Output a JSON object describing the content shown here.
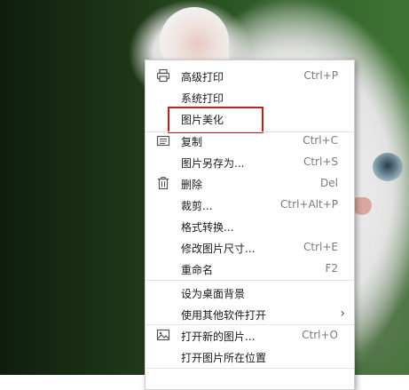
{
  "menu": {
    "items": [
      {
        "label": "高级打印",
        "shortcut": "Ctrl+P",
        "icon": "printer-icon"
      },
      {
        "label": "系统打印",
        "shortcut": ""
      },
      {
        "label": "图片美化",
        "shortcut": ""
      },
      {
        "label": "复制",
        "shortcut": "Ctrl+C",
        "icon": "copy-icon"
      },
      {
        "label": "图片另存为...",
        "shortcut": "Ctrl+S"
      },
      {
        "label": "删除",
        "shortcut": "Del",
        "icon": "trash-icon"
      },
      {
        "label": "裁剪...",
        "shortcut": "Ctrl+Alt+P"
      },
      {
        "label": "格式转换...",
        "shortcut": ""
      },
      {
        "label": "修改图片尺寸...",
        "shortcut": "Ctrl+E"
      },
      {
        "label": "重命名",
        "shortcut": "F2"
      },
      {
        "label": "设为桌面背景",
        "shortcut": ""
      },
      {
        "label": "使用其他软件打开",
        "shortcut": "",
        "submenu": true
      },
      {
        "label": "打开新的图片...",
        "shortcut": "Ctrl+O",
        "icon": "image-icon"
      },
      {
        "label": "打开图片所在位置",
        "shortcut": ""
      }
    ]
  },
  "highlight_color": "#c0201e"
}
